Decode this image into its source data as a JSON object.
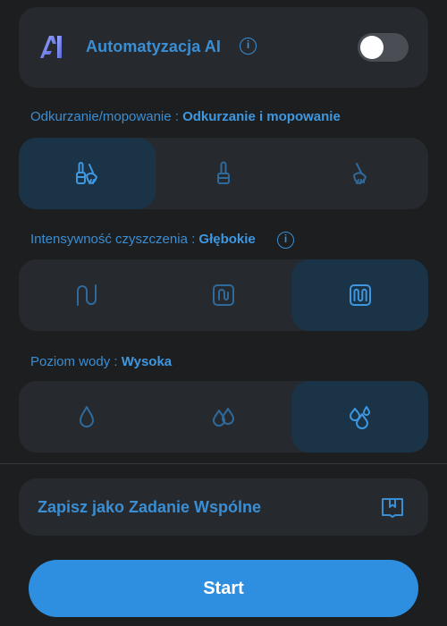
{
  "ai": {
    "label": "Automatyzacja AI",
    "info_glyph": "i",
    "toggle_on": false
  },
  "mode": {
    "label": "Odkurzanie/mopowanie : ",
    "value": "Odkurzanie i mopowanie",
    "options": [
      "vacuum-and-mop-icon",
      "vacuum-icon",
      "mop-icon"
    ],
    "selected_index": 0
  },
  "intensity": {
    "label": "Intensywność czyszczenia : ",
    "value": "Głębokie",
    "info_glyph": "i",
    "options": [
      "route-simple-icon",
      "route-standard-icon",
      "route-deep-icon"
    ],
    "selected_index": 2
  },
  "water": {
    "label": "Poziom wody : ",
    "value": "Wysoka",
    "options": [
      "water-low-icon",
      "water-medium-icon",
      "water-high-icon"
    ],
    "selected_index": 2
  },
  "save": {
    "label": "Zapisz jako Zadanie Wspólne",
    "icon": "bookmark-book-icon"
  },
  "start": {
    "label": "Start"
  },
  "colors": {
    "accent": "#3a8ed3",
    "accent_dim": "#2f6a9c",
    "button": "#2e8fe0",
    "card": "#26292e",
    "selected": "#1a3347",
    "background": "#1d1e20"
  }
}
